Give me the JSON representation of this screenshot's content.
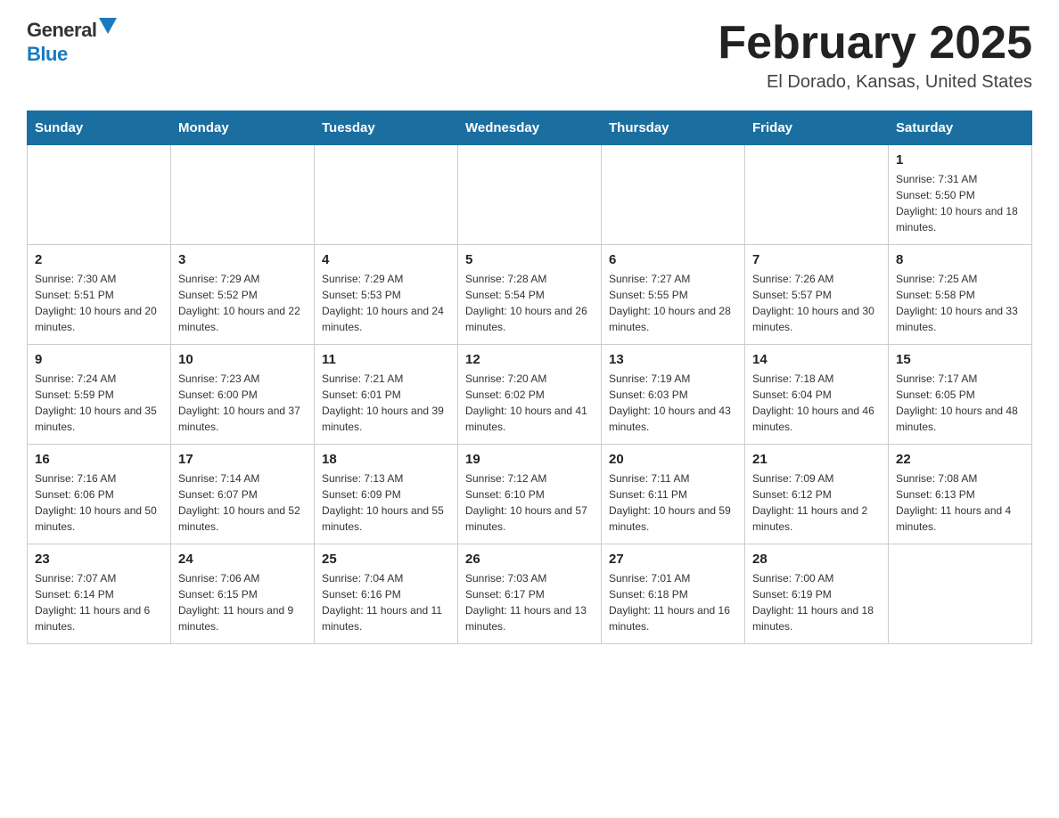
{
  "header": {
    "logo_line1": "General",
    "logo_line2": "Blue",
    "month_title": "February 2025",
    "location": "El Dorado, Kansas, United States"
  },
  "days_of_week": [
    "Sunday",
    "Monday",
    "Tuesday",
    "Wednesday",
    "Thursday",
    "Friday",
    "Saturday"
  ],
  "weeks": [
    [
      {
        "day": "",
        "sunrise": "",
        "sunset": "",
        "daylight": ""
      },
      {
        "day": "",
        "sunrise": "",
        "sunset": "",
        "daylight": ""
      },
      {
        "day": "",
        "sunrise": "",
        "sunset": "",
        "daylight": ""
      },
      {
        "day": "",
        "sunrise": "",
        "sunset": "",
        "daylight": ""
      },
      {
        "day": "",
        "sunrise": "",
        "sunset": "",
        "daylight": ""
      },
      {
        "day": "",
        "sunrise": "",
        "sunset": "",
        "daylight": ""
      },
      {
        "day": "1",
        "sunrise": "Sunrise: 7:31 AM",
        "sunset": "Sunset: 5:50 PM",
        "daylight": "Daylight: 10 hours and 18 minutes."
      }
    ],
    [
      {
        "day": "2",
        "sunrise": "Sunrise: 7:30 AM",
        "sunset": "Sunset: 5:51 PM",
        "daylight": "Daylight: 10 hours and 20 minutes."
      },
      {
        "day": "3",
        "sunrise": "Sunrise: 7:29 AM",
        "sunset": "Sunset: 5:52 PM",
        "daylight": "Daylight: 10 hours and 22 minutes."
      },
      {
        "day": "4",
        "sunrise": "Sunrise: 7:29 AM",
        "sunset": "Sunset: 5:53 PM",
        "daylight": "Daylight: 10 hours and 24 minutes."
      },
      {
        "day": "5",
        "sunrise": "Sunrise: 7:28 AM",
        "sunset": "Sunset: 5:54 PM",
        "daylight": "Daylight: 10 hours and 26 minutes."
      },
      {
        "day": "6",
        "sunrise": "Sunrise: 7:27 AM",
        "sunset": "Sunset: 5:55 PM",
        "daylight": "Daylight: 10 hours and 28 minutes."
      },
      {
        "day": "7",
        "sunrise": "Sunrise: 7:26 AM",
        "sunset": "Sunset: 5:57 PM",
        "daylight": "Daylight: 10 hours and 30 minutes."
      },
      {
        "day": "8",
        "sunrise": "Sunrise: 7:25 AM",
        "sunset": "Sunset: 5:58 PM",
        "daylight": "Daylight: 10 hours and 33 minutes."
      }
    ],
    [
      {
        "day": "9",
        "sunrise": "Sunrise: 7:24 AM",
        "sunset": "Sunset: 5:59 PM",
        "daylight": "Daylight: 10 hours and 35 minutes."
      },
      {
        "day": "10",
        "sunrise": "Sunrise: 7:23 AM",
        "sunset": "Sunset: 6:00 PM",
        "daylight": "Daylight: 10 hours and 37 minutes."
      },
      {
        "day": "11",
        "sunrise": "Sunrise: 7:21 AM",
        "sunset": "Sunset: 6:01 PM",
        "daylight": "Daylight: 10 hours and 39 minutes."
      },
      {
        "day": "12",
        "sunrise": "Sunrise: 7:20 AM",
        "sunset": "Sunset: 6:02 PM",
        "daylight": "Daylight: 10 hours and 41 minutes."
      },
      {
        "day": "13",
        "sunrise": "Sunrise: 7:19 AM",
        "sunset": "Sunset: 6:03 PM",
        "daylight": "Daylight: 10 hours and 43 minutes."
      },
      {
        "day": "14",
        "sunrise": "Sunrise: 7:18 AM",
        "sunset": "Sunset: 6:04 PM",
        "daylight": "Daylight: 10 hours and 46 minutes."
      },
      {
        "day": "15",
        "sunrise": "Sunrise: 7:17 AM",
        "sunset": "Sunset: 6:05 PM",
        "daylight": "Daylight: 10 hours and 48 minutes."
      }
    ],
    [
      {
        "day": "16",
        "sunrise": "Sunrise: 7:16 AM",
        "sunset": "Sunset: 6:06 PM",
        "daylight": "Daylight: 10 hours and 50 minutes."
      },
      {
        "day": "17",
        "sunrise": "Sunrise: 7:14 AM",
        "sunset": "Sunset: 6:07 PM",
        "daylight": "Daylight: 10 hours and 52 minutes."
      },
      {
        "day": "18",
        "sunrise": "Sunrise: 7:13 AM",
        "sunset": "Sunset: 6:09 PM",
        "daylight": "Daylight: 10 hours and 55 minutes."
      },
      {
        "day": "19",
        "sunrise": "Sunrise: 7:12 AM",
        "sunset": "Sunset: 6:10 PM",
        "daylight": "Daylight: 10 hours and 57 minutes."
      },
      {
        "day": "20",
        "sunrise": "Sunrise: 7:11 AM",
        "sunset": "Sunset: 6:11 PM",
        "daylight": "Daylight: 10 hours and 59 minutes."
      },
      {
        "day": "21",
        "sunrise": "Sunrise: 7:09 AM",
        "sunset": "Sunset: 6:12 PM",
        "daylight": "Daylight: 11 hours and 2 minutes."
      },
      {
        "day": "22",
        "sunrise": "Sunrise: 7:08 AM",
        "sunset": "Sunset: 6:13 PM",
        "daylight": "Daylight: 11 hours and 4 minutes."
      }
    ],
    [
      {
        "day": "23",
        "sunrise": "Sunrise: 7:07 AM",
        "sunset": "Sunset: 6:14 PM",
        "daylight": "Daylight: 11 hours and 6 minutes."
      },
      {
        "day": "24",
        "sunrise": "Sunrise: 7:06 AM",
        "sunset": "Sunset: 6:15 PM",
        "daylight": "Daylight: 11 hours and 9 minutes."
      },
      {
        "day": "25",
        "sunrise": "Sunrise: 7:04 AM",
        "sunset": "Sunset: 6:16 PM",
        "daylight": "Daylight: 11 hours and 11 minutes."
      },
      {
        "day": "26",
        "sunrise": "Sunrise: 7:03 AM",
        "sunset": "Sunset: 6:17 PM",
        "daylight": "Daylight: 11 hours and 13 minutes."
      },
      {
        "day": "27",
        "sunrise": "Sunrise: 7:01 AM",
        "sunset": "Sunset: 6:18 PM",
        "daylight": "Daylight: 11 hours and 16 minutes."
      },
      {
        "day": "28",
        "sunrise": "Sunrise: 7:00 AM",
        "sunset": "Sunset: 6:19 PM",
        "daylight": "Daylight: 11 hours and 18 minutes."
      },
      {
        "day": "",
        "sunrise": "",
        "sunset": "",
        "daylight": ""
      }
    ]
  ]
}
